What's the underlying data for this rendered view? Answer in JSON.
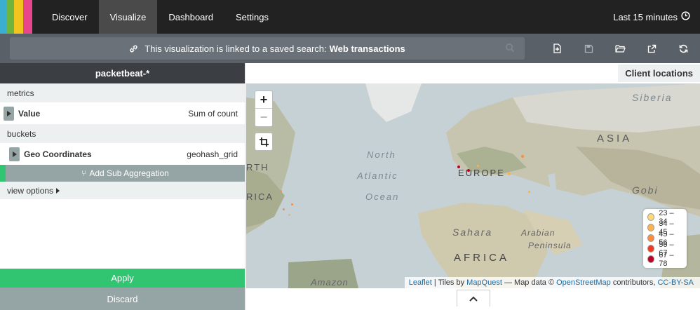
{
  "nav": {
    "logo_colors": [
      "#3caed2",
      "#6eb43f",
      "#f1c51e",
      "#e8488b"
    ],
    "tabs": [
      {
        "label": "Discover"
      },
      {
        "label": "Visualize",
        "active": true
      },
      {
        "label": "Dashboard"
      },
      {
        "label": "Settings"
      }
    ],
    "timepicker": "Last 15 minutes"
  },
  "searchbar": {
    "linked_text": "This visualization is linked to a saved search:",
    "saved_search": "Web transactions",
    "icons": [
      "link-icon",
      "search-icon",
      "new-document-icon",
      "save-icon",
      "open-folder-icon",
      "share-icon",
      "refresh-icon"
    ]
  },
  "sidebar": {
    "title": "packetbeat-*",
    "metrics_label": "metrics",
    "metric": {
      "name": "Value",
      "value": "Sum of count"
    },
    "buckets_label": "buckets",
    "bucket": {
      "name": "Geo Coordinates",
      "value": "geohash_grid"
    },
    "add_sub_label": "Add Sub Aggregation",
    "view_options": "view options",
    "apply": "Apply",
    "discard": "Discard"
  },
  "visualization": {
    "title": "Client locations",
    "map_labels": {
      "siberia": "Siberia",
      "asia": "ASIA",
      "north": "North",
      "atlantic": "Atlantic",
      "ocean": "Ocean",
      "europe": "EUROPE",
      "rth": "RTH",
      "rica": "RICA",
      "gobi": "Gobi",
      "sahara": "Sahara",
      "arabian": "Arabian",
      "peninsula": "Peninsula",
      "africa": "AFRICA",
      "amazon": "Amazon"
    },
    "legend": [
      {
        "label": "23 – 34",
        "color": "#fed976"
      },
      {
        "label": "34 – 45",
        "color": "#feb24c"
      },
      {
        "label": "45 – 56",
        "color": "#fd8d3c"
      },
      {
        "label": "56 – 67",
        "color": "#f03b20"
      },
      {
        "label": "67 – 78",
        "color": "#bd0026"
      }
    ],
    "attribution": {
      "leaflet": "Leaflet",
      "tiles": "| Tiles by",
      "mapquest": "MapQuest",
      "mapdata": "— Map data ©",
      "osm": "OpenStreetMap",
      "contributors": "contributors,",
      "license": "CC-BY-SA"
    }
  },
  "colors": {
    "nav_bg": "#222222",
    "accent_green": "#31c471",
    "gray_button": "#95a5a6"
  }
}
